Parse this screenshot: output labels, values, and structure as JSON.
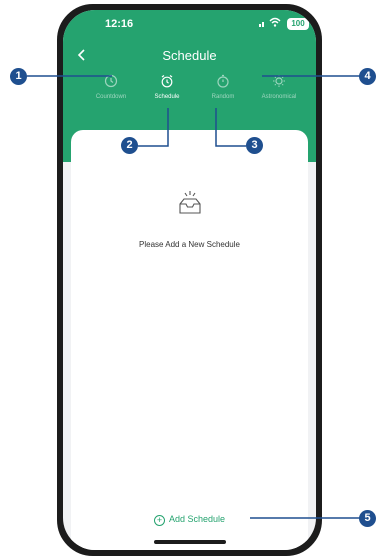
{
  "status_bar": {
    "time": "12:16",
    "battery": "100"
  },
  "nav": {
    "back_icon": "chevron-left-icon",
    "title": "Schedule"
  },
  "tabs": [
    {
      "label": "Countdown",
      "icon": "clock-icon",
      "active": false
    },
    {
      "label": "Schedule",
      "icon": "alarm-icon",
      "active": true
    },
    {
      "label": "Random",
      "icon": "timer-icon",
      "active": false
    },
    {
      "label": "Astronomical",
      "icon": "sun-icon",
      "active": false
    }
  ],
  "empty_state": {
    "icon": "empty-tray-icon",
    "message": "Please Add a New Schedule"
  },
  "add_button": {
    "label": "Add Schedule",
    "icon": "add-circle-icon"
  },
  "callouts": [
    "1",
    "2",
    "3",
    "4",
    "5"
  ],
  "colors": {
    "primary": "#25a36f",
    "callout": "#1f4f8f",
    "background": "#f1f2f4"
  }
}
